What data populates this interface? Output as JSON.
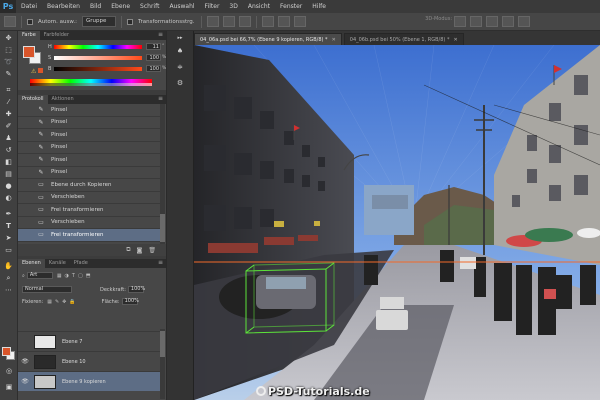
{
  "app": {
    "logo": "Ps"
  },
  "menu": [
    "Datei",
    "Bearbeiten",
    "Bild",
    "Ebene",
    "Schrift",
    "Auswahl",
    "Filter",
    "3D",
    "Ansicht",
    "Fenster",
    "Hilfe"
  ],
  "options": {
    "auto_select_label": "Autom. ausw.:",
    "auto_select_value": "Gruppe",
    "transform_label": "Transformationsstrg.",
    "mode_3d_label": "3D-Modus:"
  },
  "panels": {
    "color_tabs": [
      "Farbe",
      "Farbfelder"
    ],
    "color": {
      "fg_color": "#d9552a",
      "bg_color": "#f0f0f0",
      "sliders": [
        {
          "label": "H",
          "value": "11",
          "unit": "°"
        },
        {
          "label": "S",
          "value": "100",
          "unit": "%"
        },
        {
          "label": "B",
          "value": "100",
          "unit": "%"
        }
      ]
    },
    "history_tabs": [
      "Protokoll",
      "Aktionen"
    ],
    "history": [
      {
        "icon": "brush-icon",
        "label": "Pinsel"
      },
      {
        "icon": "brush-icon",
        "label": "Pinsel"
      },
      {
        "icon": "brush-icon",
        "label": "Pinsel"
      },
      {
        "icon": "brush-icon",
        "label": "Pinsel"
      },
      {
        "icon": "brush-icon",
        "label": "Pinsel"
      },
      {
        "icon": "brush-icon",
        "label": "Pinsel"
      },
      {
        "icon": "layer-icon",
        "label": "Ebene durch Kopieren"
      },
      {
        "icon": "move-icon",
        "label": "Verschieben"
      },
      {
        "icon": "transform-icon",
        "label": "Frei transformieren"
      },
      {
        "icon": "move-icon",
        "label": "Verschieben"
      },
      {
        "icon": "transform-icon",
        "label": "Frei transformieren"
      }
    ],
    "history_selected_index": 10,
    "layers_tabs": [
      "Ebenen",
      "Kanäle",
      "Pfade"
    ],
    "layers": {
      "filter_label": "Art",
      "blend_mode": "Normal",
      "opacity_label": "Deckkraft:",
      "opacity_value": "100%",
      "lock_label": "Fixieren:",
      "fill_label": "Fläche:",
      "fill_value": "100%",
      "items": [
        {
          "name": "Ebene 7",
          "visible": false,
          "thumb": "#e8e8e8"
        },
        {
          "name": "Ebene 10",
          "visible": true,
          "thumb": "#2a2a2a"
        },
        {
          "name": "Ebene 9 kopieren",
          "visible": true,
          "thumb": "#c8c8c8",
          "selected": true
        }
      ]
    }
  },
  "documents": {
    "tabs": [
      {
        "title": "04_06a.psd bei 66,7% (Ebene 9 kopieren, RGB/8) *",
        "active": true
      },
      {
        "title": "04_06b.psd bei 50% (Ebene 1, RGB/8) *",
        "active": false
      }
    ]
  },
  "watermark": {
    "text": "PSD-Tutorials.de"
  }
}
